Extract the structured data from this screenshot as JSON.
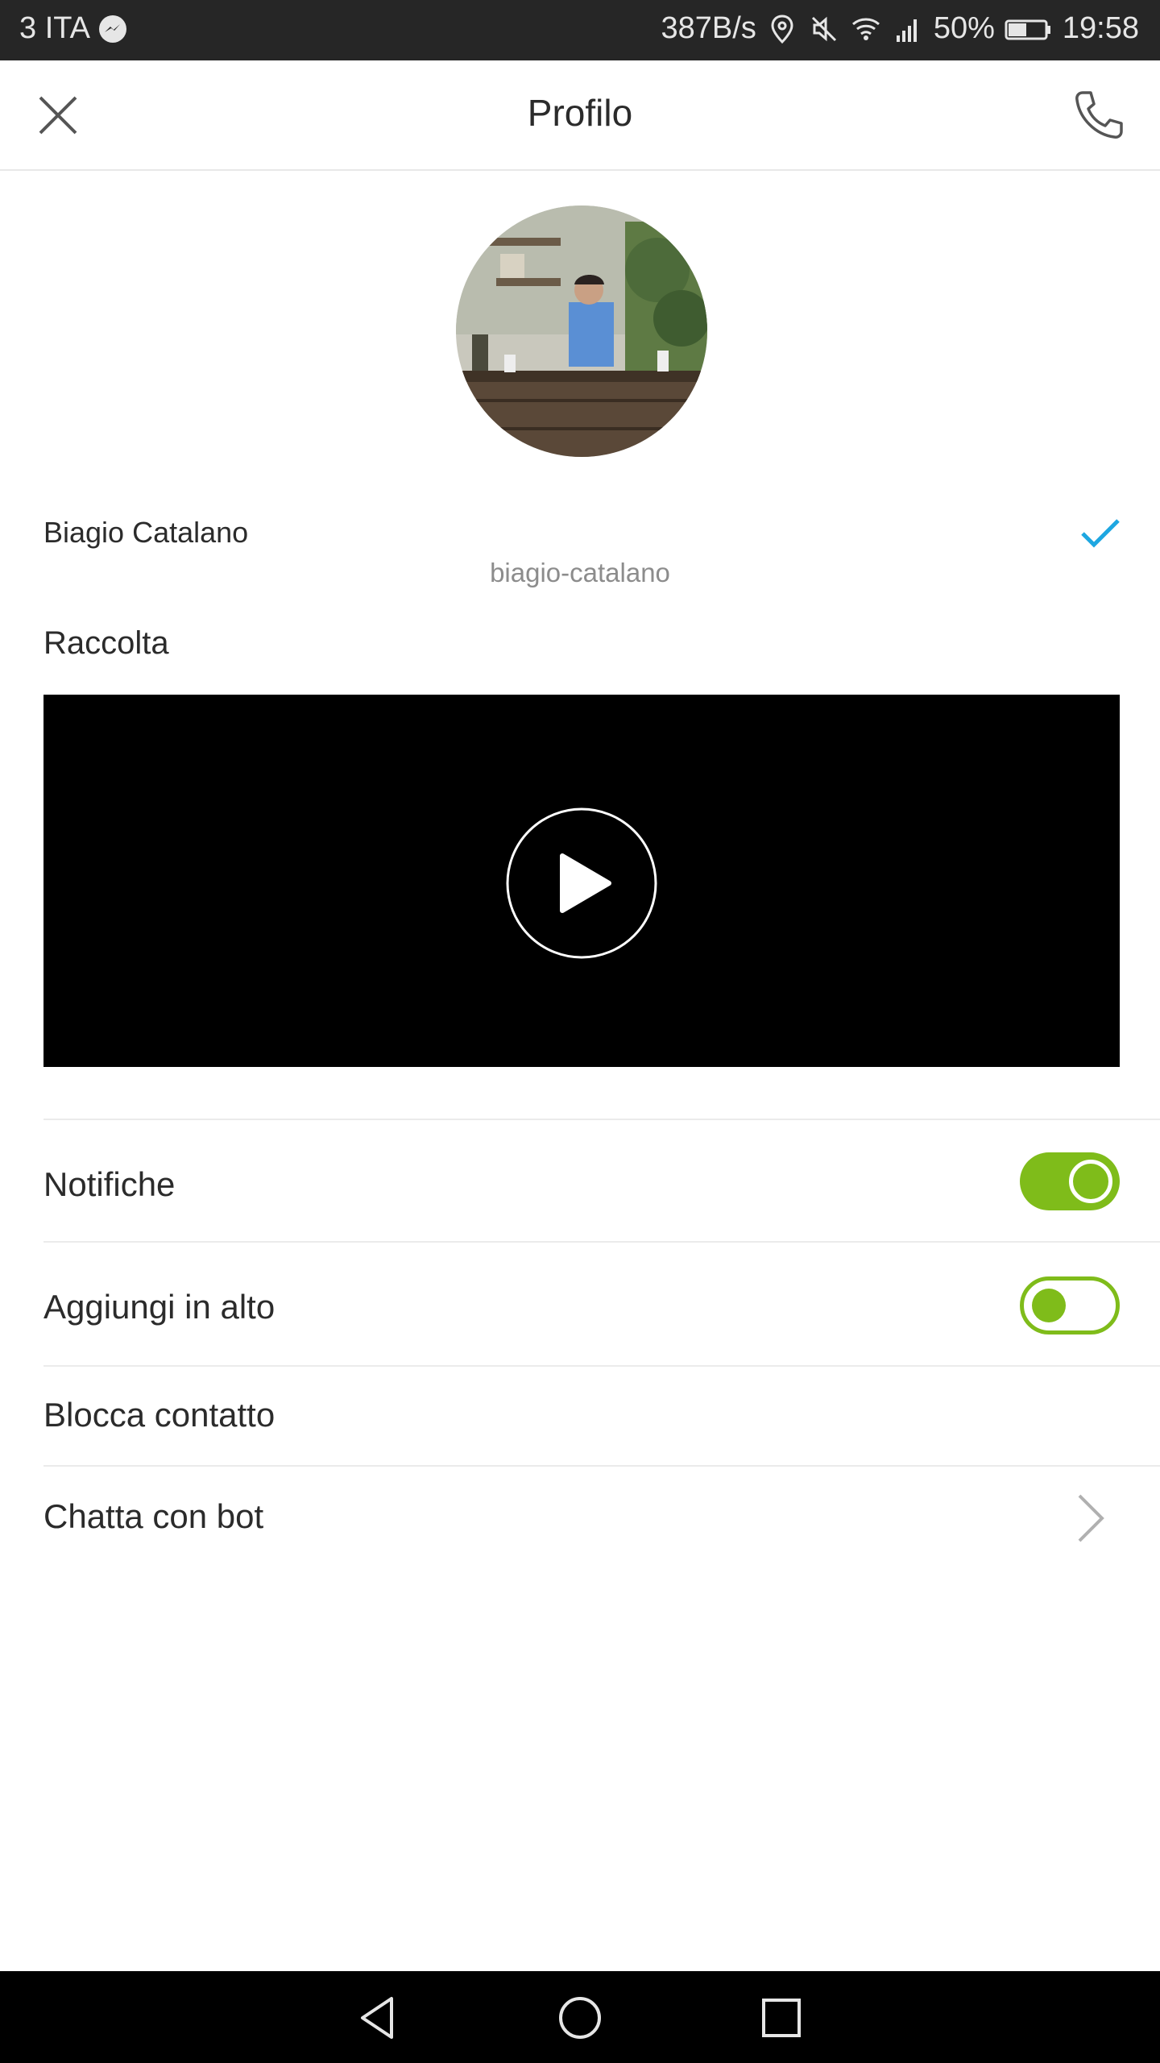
{
  "status_bar": {
    "carrier": "3 ITA",
    "net_speed": "387B/s",
    "battery": "50%",
    "time": "19:58"
  },
  "header": {
    "title": "Profilo",
    "close_icon": "close-icon",
    "call_icon": "phone-icon"
  },
  "profile": {
    "name": "Biagio Catalano",
    "handle": "biagio-catalano",
    "verified_icon": "checkmark-icon"
  },
  "collection": {
    "title": "Raccolta",
    "play_icon": "play-icon"
  },
  "settings": [
    {
      "label": "Notifiche",
      "toggle": true
    },
    {
      "label": "Aggiungi in alto",
      "toggle": false
    },
    {
      "label": "Blocca contatto"
    },
    {
      "label": "Chatta con bot",
      "icon": "chevron-right-icon"
    }
  ],
  "colors": {
    "accent_green": "#7fbc1a",
    "verified_blue": "#1ea7e1",
    "status_bar": "#262626"
  }
}
